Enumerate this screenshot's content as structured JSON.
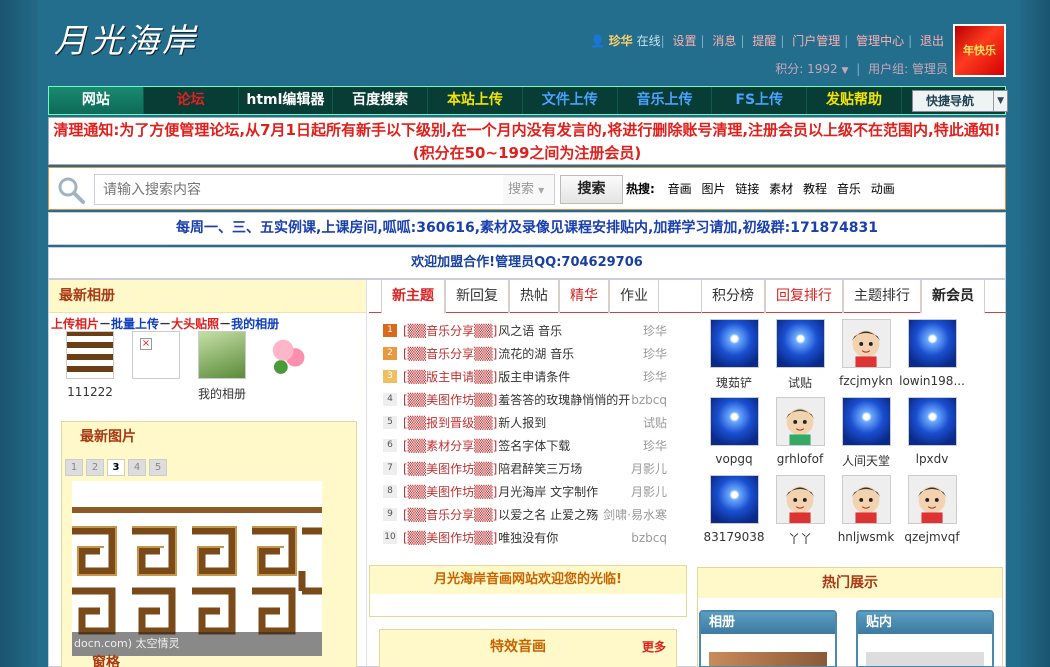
{
  "header": {
    "logo": "月光海岸",
    "user": "珍华",
    "online": "在线",
    "links": [
      "设置",
      "消息",
      "提醒",
      "门户管理",
      "管理中心",
      "退出"
    ],
    "credits": "积分: 1992",
    "usergroup": "用户组: 管理员",
    "avatar_text": "年快乐"
  },
  "nav": {
    "items": [
      {
        "label": "网站",
        "color": "#ffffff"
      },
      {
        "label": "论坛",
        "color": "#e52020"
      },
      {
        "label": "html编辑器",
        "color": "#ffffff"
      },
      {
        "label": "百度搜索",
        "color": "#ffffff"
      },
      {
        "label": "本站上传",
        "color": "#f5e400"
      },
      {
        "label": "文件上传",
        "color": "#4aa2ff"
      },
      {
        "label": "音乐上传",
        "color": "#4aa2ff"
      },
      {
        "label": "FS上传",
        "color": "#4aa2ff"
      },
      {
        "label": "发贴帮助",
        "color": "#f5e400"
      }
    ],
    "quick": "快捷导航"
  },
  "notice": "清理通知:为了方便管理论坛,从7月1日起所有新手以下级别,在一个月内没有发言的,将进行删除账号清理,注册会员以上级不在范围内,特此通知!(积分在50~199之间为注册会员)",
  "search": {
    "placeholder": "请输入搜索内容",
    "type": "搜索",
    "button": "搜索",
    "hot_label": "热搜:",
    "hot_words": [
      "音画",
      "图片",
      "链接",
      "素材",
      "教程",
      "音乐",
      "动画"
    ]
  },
  "notice2": "每周一、三、五实例课,上课房间,呱呱:360616,素材及录像见课程安排贴内,加群学习请加,初级群:171874831",
  "notice3": "欢迎加盟合作!管理员QQ:704629706",
  "album": {
    "title": "最新相册",
    "links": [
      "上传相片",
      "批量上传",
      "大头贴照",
      "我的相册"
    ],
    "items": [
      {
        "name": "111222"
      },
      {
        "name": ""
      },
      {
        "name": "我的相册"
      },
      {
        "name": ""
      }
    ]
  },
  "pictures": {
    "title": "最新图片",
    "pages": [
      "1",
      "2",
      "3",
      "4",
      "5"
    ],
    "current": "3",
    "caption": "docn.com) 太空情灵",
    "label": "窗格"
  },
  "topic_tabs": [
    "新主题",
    "新回复",
    "热帖",
    "精华",
    "作业"
  ],
  "topics": [
    {
      "num": "1",
      "cat": "[▒▒音乐分享▒▒]",
      "title": "风之语 音乐",
      "author": "珍华"
    },
    {
      "num": "2",
      "cat": "[▒▒音乐分享▒▒]",
      "title": "流花的湖 音乐",
      "author": "珍华"
    },
    {
      "num": "3",
      "cat": "[▒▒版主申请▒▒]",
      "title": "版主申请条件",
      "author": "珍华"
    },
    {
      "num": "4",
      "cat": "[▒▒美图作坊▒▒]",
      "title": "羞答答的玫瑰静悄悄的开",
      "author": "bzbcq"
    },
    {
      "num": "5",
      "cat": "[▒▒报到晋级▒▒]",
      "title": "新人报到",
      "author": "试贴"
    },
    {
      "num": "6",
      "cat": "[▒▒素材分享▒▒]",
      "title": "签名字体下载",
      "author": "珍华"
    },
    {
      "num": "7",
      "cat": "[▒▒美图作坊▒▒]",
      "title": "陪君醉笑三万场",
      "author": "月影儿"
    },
    {
      "num": "8",
      "cat": "[▒▒美图作坊▒▒]",
      "title": "月光海岸 文字制作",
      "author": "月影儿"
    },
    {
      "num": "9",
      "cat": "[▒▒音乐分享▒▒]",
      "title": "以爱之名 止爱之殇",
      "author": "剑啸·易水寒"
    },
    {
      "num": "10",
      "cat": "[▒▒美图作坊▒▒]",
      "title": "唯独没有你",
      "author": "bzbcq"
    }
  ],
  "welcome": "月光海岸音画网站欢迎您的光临!",
  "effects": {
    "title": "特效音画",
    "more": "更多"
  },
  "member_tabs": [
    "积分榜",
    "回复排行",
    "主题排行",
    "新会员"
  ],
  "members": [
    {
      "name": "瑰茹铲",
      "pic": "moon"
    },
    {
      "name": "试贴",
      "pic": "moon"
    },
    {
      "name": "fzcjmykn",
      "pic": "face"
    },
    {
      "name": "lowin198...",
      "pic": "moon"
    },
    {
      "name": "vopgq",
      "pic": "moon"
    },
    {
      "name": "grhlofof",
      "pic": "face"
    },
    {
      "name": "人间天堂",
      "pic": "moon"
    },
    {
      "name": "lpxdv",
      "pic": "moon"
    },
    {
      "name": "83179038",
      "pic": "moon"
    },
    {
      "name": "丫丫",
      "pic": "face"
    },
    {
      "name": "hnljwsmk",
      "pic": "face"
    },
    {
      "name": "qzejmvqf",
      "pic": "face"
    }
  ],
  "hot_show": {
    "title": "热门展示",
    "panels": [
      "相册",
      "贴内"
    ]
  }
}
